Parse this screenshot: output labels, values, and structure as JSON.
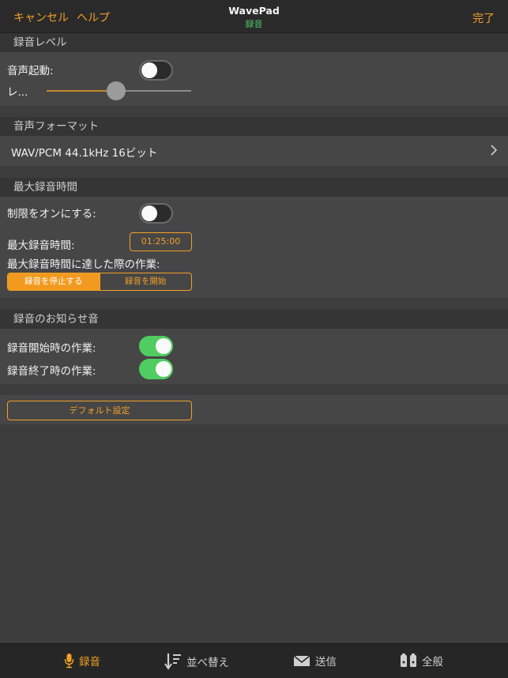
{
  "nav": {
    "cancel": "キャンセル",
    "help": "ヘルプ",
    "title": "WavePad",
    "subtitle": "録音",
    "done": "完了"
  },
  "record_level": {
    "header": "録音レベル",
    "voice_activation_label": "音声起動:",
    "voice_activation_on": false,
    "level_label": "レ...",
    "level_value": 0.48
  },
  "audio_format": {
    "header": "音声フォーマット",
    "value": "WAV/PCM 44.1kHz 16ビット"
  },
  "max_time": {
    "header": "最大録音時間",
    "enable_label": "制限をオンにする:",
    "enable_on": false,
    "time_label": "最大録音時間:",
    "time_value": "01:25:00",
    "action_label": "最大録音時間に達した際の作業:",
    "actions": [
      "録音を停止する",
      "録音を開始"
    ],
    "selected_action": 0
  },
  "notification": {
    "header": "録音のお知らせ音",
    "start_label": "録音開始時の作業:",
    "start_on": true,
    "end_label": "録音終了時の作業:",
    "end_on": true
  },
  "default_button": "デフォルト設定",
  "tabs": [
    {
      "label": "録音",
      "icon": "microphone-icon",
      "active": true
    },
    {
      "label": "並べ替え",
      "icon": "sort-icon",
      "active": false
    },
    {
      "label": "送信",
      "icon": "envelope-icon",
      "active": false
    },
    {
      "label": "全般",
      "icon": "general-settings-icon",
      "active": false
    }
  ],
  "colors": {
    "accent": "#f2a028",
    "toggle_on": "#4fcd60",
    "background": "#3d3d3d"
  }
}
